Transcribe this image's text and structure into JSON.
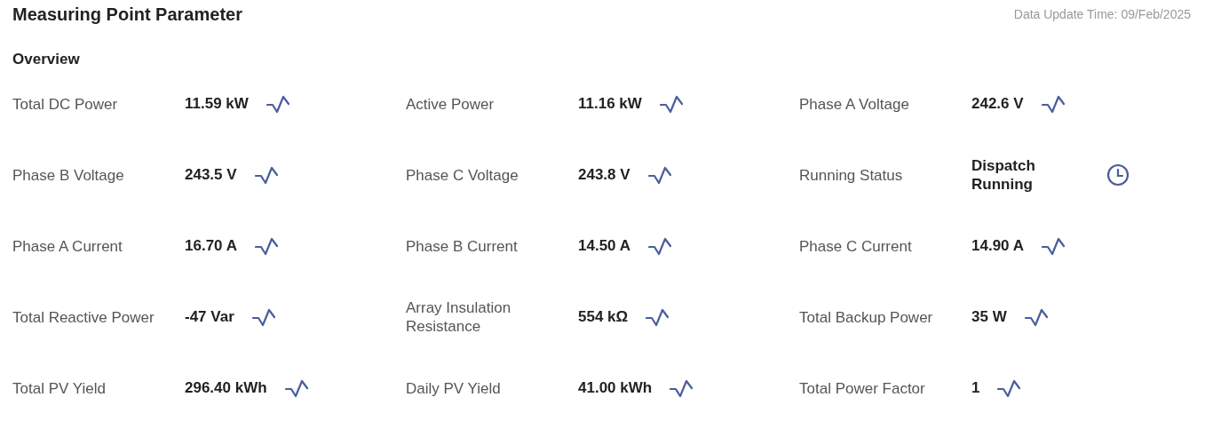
{
  "header": {
    "title": "Measuring Point Parameter",
    "update_time": "Data Update Time: 09/Feb/2025"
  },
  "section": {
    "title": "Overview"
  },
  "parameters": [
    {
      "label": "Total DC Power",
      "value": "11.59 kW",
      "kind": "trend"
    },
    {
      "label": "Active Power",
      "value": "11.16 kW",
      "kind": "trend"
    },
    {
      "label": "Phase A Voltage",
      "value": "242.6 V",
      "kind": "trend"
    },
    {
      "label": "Phase B Voltage",
      "value": "243.5 V",
      "kind": "trend"
    },
    {
      "label": "Phase C Voltage",
      "value": "243.8 V",
      "kind": "trend"
    },
    {
      "label": "Running Status",
      "value": "Dispatch Running",
      "kind": "history"
    },
    {
      "label": "Phase A Current",
      "value": "16.70 A",
      "kind": "trend"
    },
    {
      "label": "Phase B Current",
      "value": "14.50 A",
      "kind": "trend"
    },
    {
      "label": "Phase C Current",
      "value": "14.90 A",
      "kind": "trend"
    },
    {
      "label": "Total Reactive Power",
      "value": "-47 Var",
      "kind": "trend"
    },
    {
      "label": "Array Insulation Resistance",
      "value": "554 kΩ",
      "kind": "trend"
    },
    {
      "label": "Total Backup Power",
      "value": "35 W",
      "kind": "trend"
    },
    {
      "label": "Total PV Yield",
      "value": "296.40 kWh",
      "kind": "trend"
    },
    {
      "label": "Daily PV Yield",
      "value": "41.00 kWh",
      "kind": "trend"
    },
    {
      "label": "Total Power Factor",
      "value": "1",
      "kind": "trend"
    }
  ]
}
